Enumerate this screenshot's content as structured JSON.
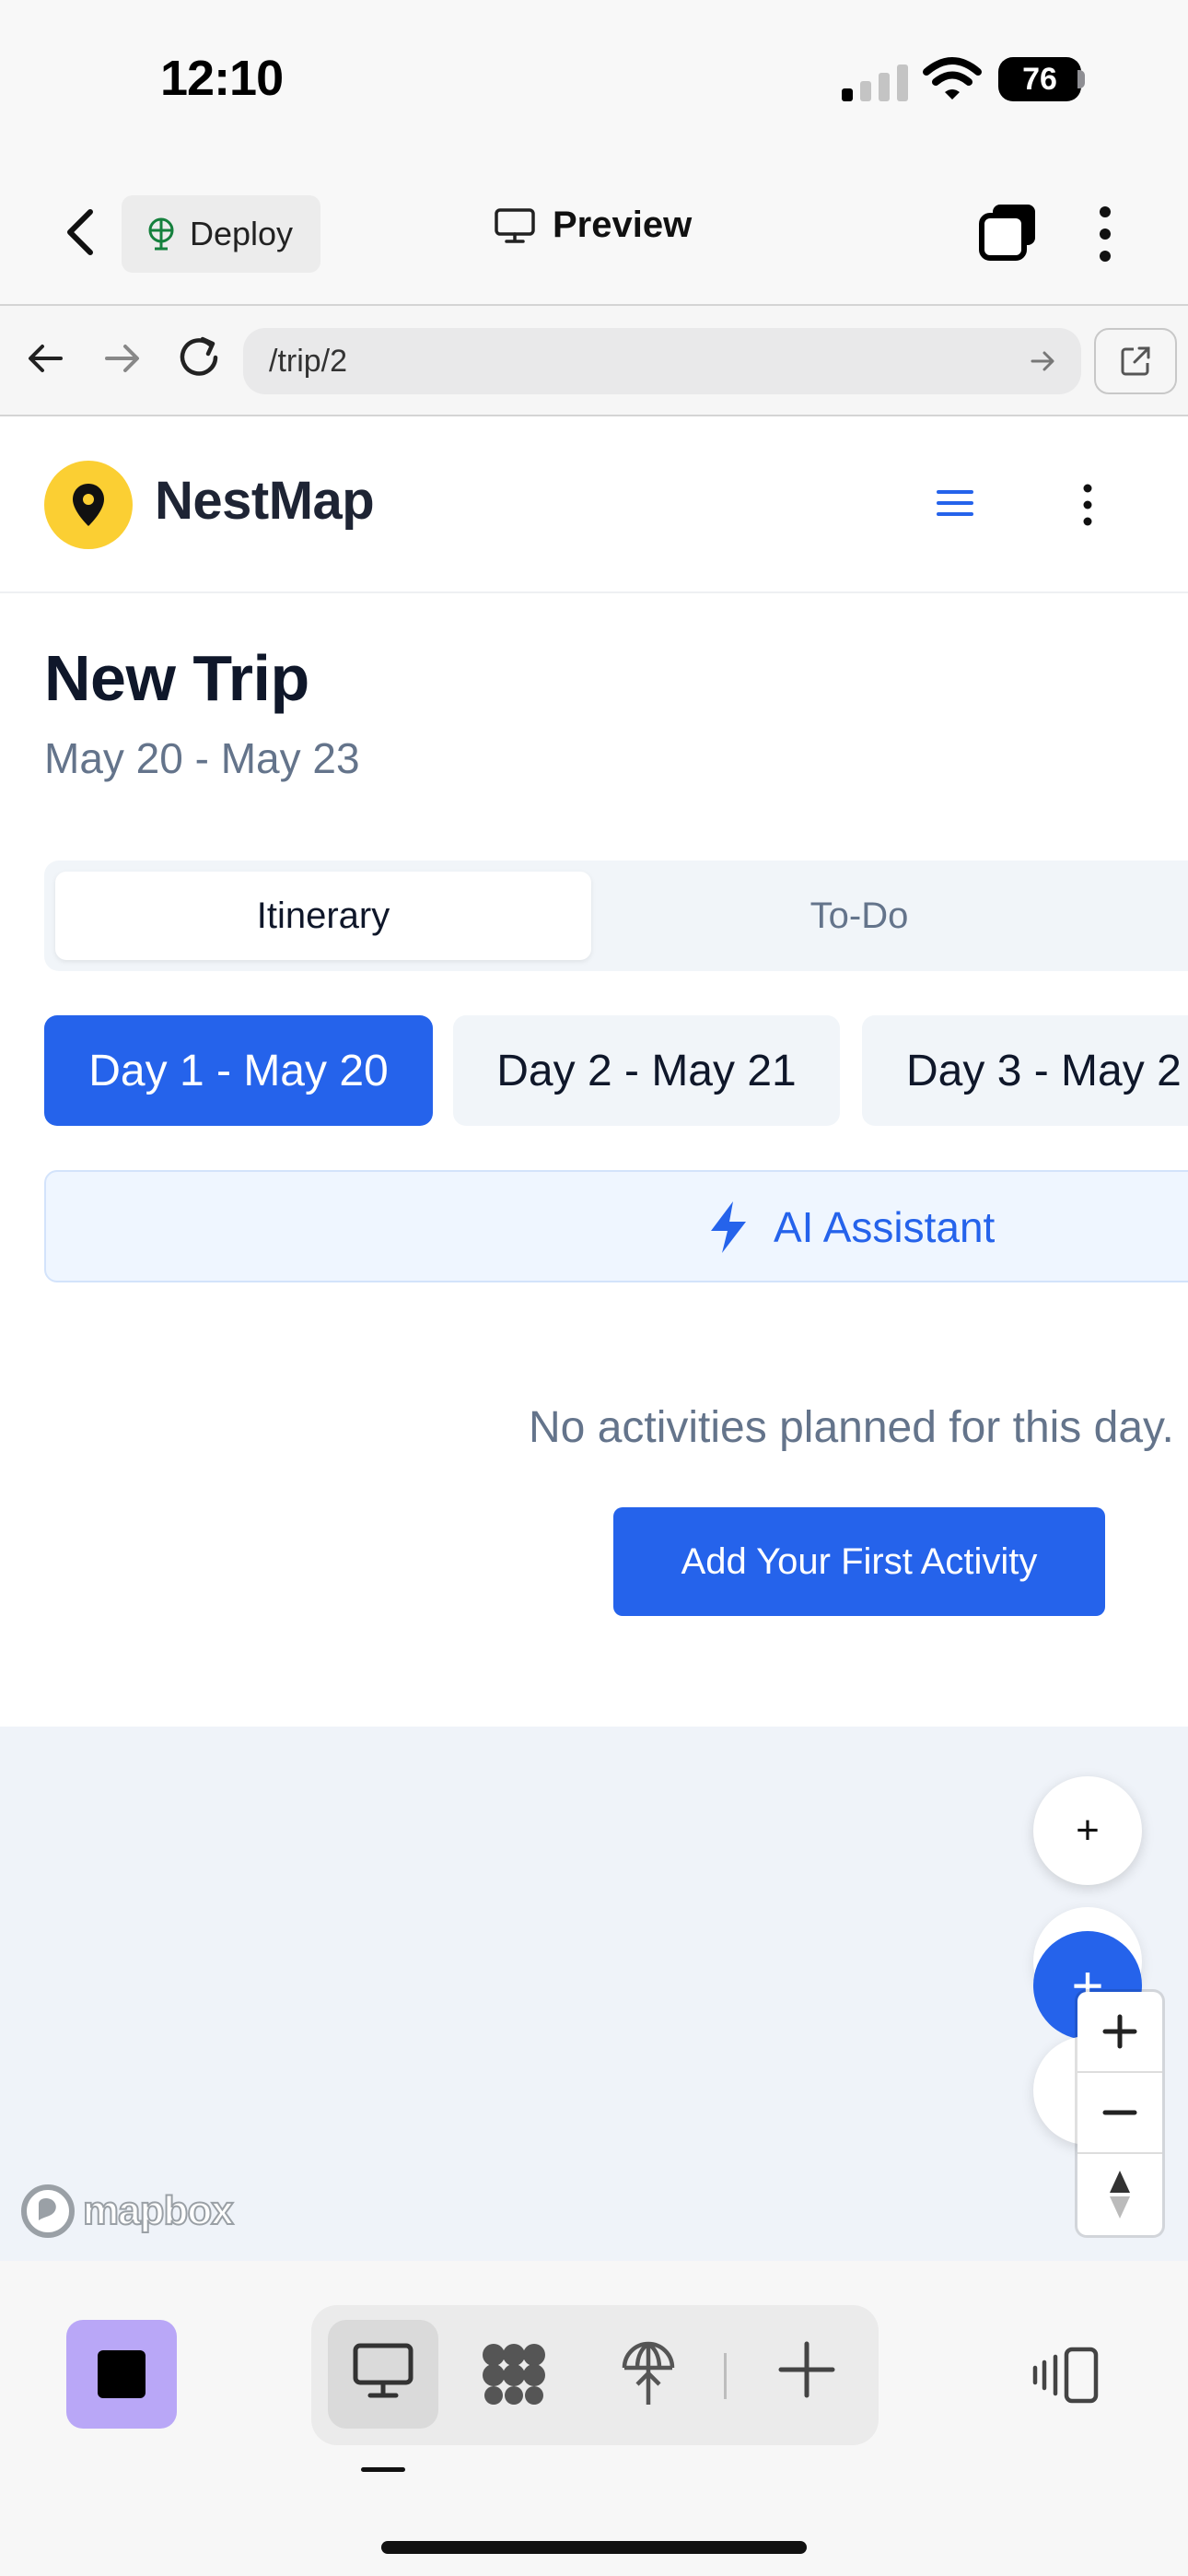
{
  "status_bar": {
    "time": "12:10",
    "battery": "76"
  },
  "app_header": {
    "deploy_label": "Deploy",
    "preview_label": "Preview"
  },
  "browser": {
    "url": "/trip/2"
  },
  "web": {
    "brand": "NestMap",
    "trip_title": "New Trip",
    "trip_dates": "May 20 - May 23",
    "tabs": [
      {
        "label": "Itinerary",
        "active": true
      },
      {
        "label": "To-Do",
        "active": false
      }
    ],
    "days": [
      {
        "label": "Day 1 - May 20",
        "active": true
      },
      {
        "label": "Day 2 - May 21"
      },
      {
        "label": "Day 3 - May 2"
      }
    ],
    "ai_assistant_label": "AI Assistant",
    "empty_message": "No activities planned for this day.",
    "add_first_label": "Add Your First Activity"
  },
  "map": {
    "fab_plus": "+",
    "fab_blue_plus": "+",
    "attribution": "mapbox"
  },
  "colors": {
    "primary": "#2563eb",
    "logo_yellow": "#fbcf33",
    "stop_purple": "#b9a7f7"
  }
}
